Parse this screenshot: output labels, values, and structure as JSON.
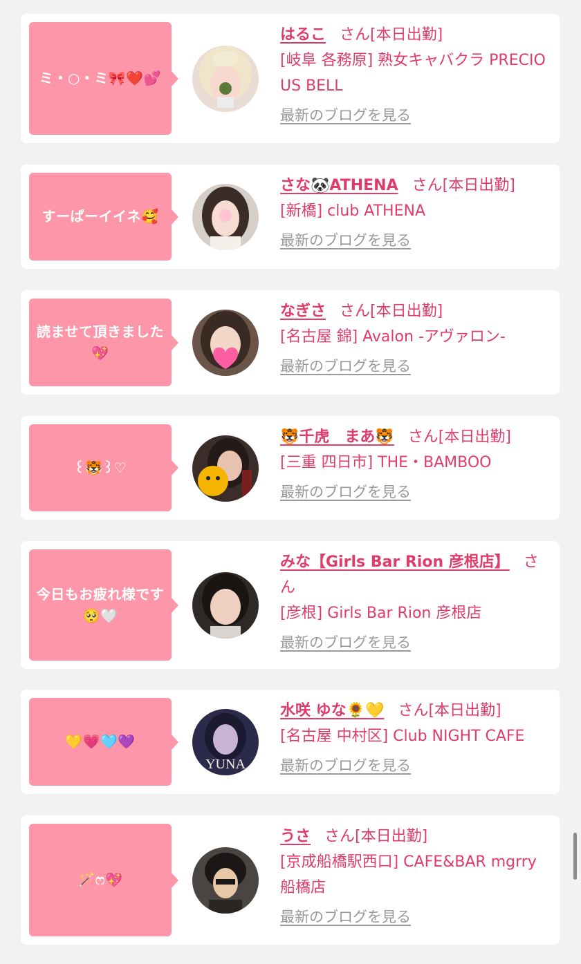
{
  "colors": {
    "page_background": "#f2f2f2",
    "card_background": "#ffffff",
    "bubble": "#fd96a8",
    "accent_text": "#e03c6b",
    "link_gray": "#999999"
  },
  "entries": [
    {
      "comment": "ミ・○・ミ🎀❤️💕",
      "avatar": "hostess-avatar",
      "name": "はるこ",
      "suffix": "さん[本日出勤]",
      "shop": "[岐阜 各務原] 熟女キャバクラ PRECIOUS BELL",
      "blog_link": "最新のブログを見る"
    },
    {
      "comment": "すーぱーイイネ🥰",
      "avatar": "hostess-avatar",
      "name": "さな🐼ATHENA",
      "suffix": "さん[本日出勤]",
      "shop": "[新橋] club ATHENA",
      "blog_link": "最新のブログを見る"
    },
    {
      "comment": "読ませて頂きました💖",
      "avatar": "hostess-avatar",
      "name": "なぎさ",
      "suffix": "さん[本日出勤]",
      "shop": "[名古屋 錦] Avalon -アヴァロン-",
      "blog_link": "最新のブログを見る"
    },
    {
      "comment": "꒰🐯꒱♡",
      "avatar": "hostess-avatar",
      "name": "🐯千虎　まあ🐯",
      "suffix": "さん[本日出勤]",
      "shop": "[三重 四日市] THE・BAMBOO",
      "blog_link": "最新のブログを見る"
    },
    {
      "comment": "今日もお疲れ様です🥺🤍",
      "avatar": "hostess-avatar",
      "name": "みな【Girls Bar Rion 彦根店】",
      "suffix": "さん",
      "shop": "[彦根] Girls Bar Rion 彦根店",
      "blog_link": "最新のブログを見る"
    },
    {
      "comment": "💛💗🩵💜",
      "avatar": "hostess-avatar",
      "avatar_caption": "YUNA",
      "name": "水咲 ゆな🌻💛",
      "suffix": "さん[本日出勤]",
      "shop": "[名古屋 中村区] Club NIGHT CAFE",
      "blog_link": "最新のブログを見る"
    },
    {
      "comment": "🪄ෆ💖",
      "avatar": "hostess-avatar",
      "name": "うさ",
      "suffix": "さん[本日出勤]",
      "shop": "[京成船橋駅西口] CAFE&BAR mgrry 船橋店",
      "blog_link": "最新のブログを見る"
    }
  ]
}
